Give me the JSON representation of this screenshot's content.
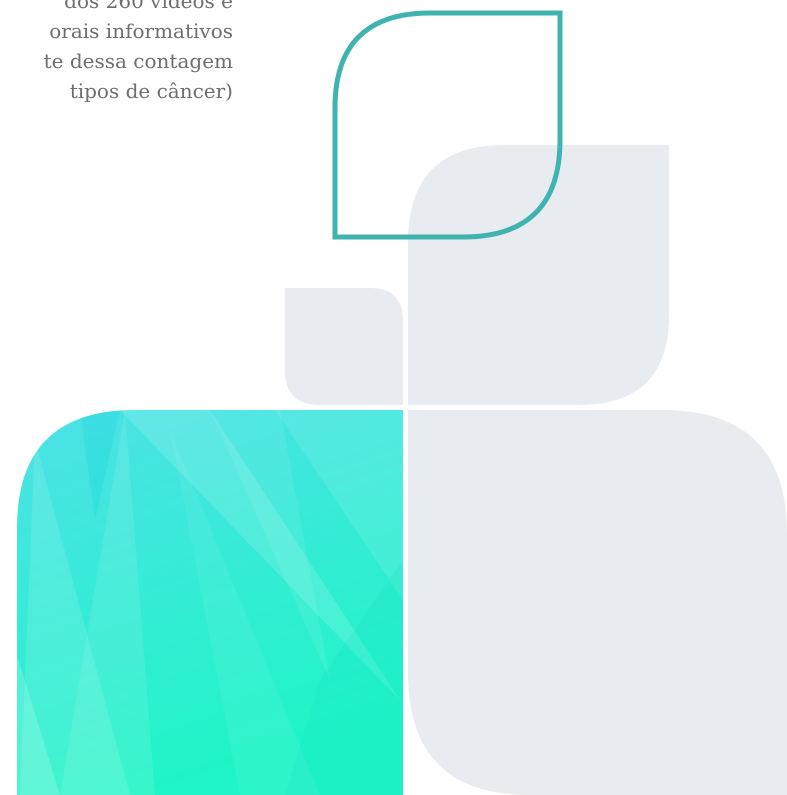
{
  "text_block": {
    "lines": [
      "dos 260 vídeos e",
      "orais informativos",
      "te dessa contagem",
      "tipos de câncer)"
    ]
  },
  "colors": {
    "text": "#6e6e6e",
    "leaf_outline": "#3fb3b0",
    "grey_shape": "#e8ebef",
    "gradient_top": "#4fe0e8",
    "gradient_bottom": "#1ff5c6"
  }
}
